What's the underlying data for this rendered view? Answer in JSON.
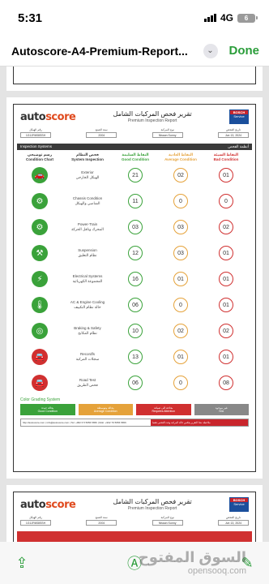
{
  "status": {
    "time": "5:31",
    "network": "4G",
    "battery": "6"
  },
  "nav": {
    "title": "Autoscore-A4-Premium-Report...",
    "done": "Done"
  },
  "report": {
    "logo_a": "auto",
    "logo_b": "score",
    "title_ar": "تقرير فحص المركبات الشامل",
    "title_en": "Premium Inspection Report",
    "bosch_top": "BOSCH",
    "bosch_bottom": "Service",
    "info": [
      {
        "label": "رقم الهيكل",
        "value": "1G1JR6S8SSH"
      },
      {
        "label": "سنة الصنع",
        "value": "2004"
      },
      {
        "label": "نوع المركبة",
        "value": "Nissan Sunny"
      },
      {
        "label": "تاريخ الفحص",
        "value": "Jun 13, 2024"
      }
    ],
    "section_en": "Inspection Systems",
    "section_ar": "أنظمة الفحص",
    "headers": {
      "chart_ar": "رسم توضيحي",
      "chart_en": "Condition Chart",
      "sys_ar": "فحص النظام",
      "sys_en": "System Inspection",
      "good_ar": "النقاط السليمة",
      "good_en": "Good Condition",
      "avg_ar": "النقاط العادية",
      "avg_en": "Average Condition",
      "bad_ar": "النقاط السيئة",
      "bad_en": "Bad Condition"
    },
    "rows": [
      {
        "en": "Exterior",
        "ar": "الهيكل الخارجي",
        "good": "21",
        "avg": "02",
        "bad": "01",
        "icon": "car-icon",
        "glyph": "🚗",
        "red": false
      },
      {
        "en": "Chassis Condition",
        "ar": "الشاصي والهيكل",
        "good": "11",
        "avg": "0",
        "bad": "0",
        "icon": "chassis-icon",
        "glyph": "⚙",
        "red": false
      },
      {
        "en": "Power-Train",
        "ar": "المحرك وناقل الحركة",
        "good": "03",
        "avg": "03",
        "bad": "02",
        "icon": "engine-icon",
        "glyph": "⚙",
        "red": false
      },
      {
        "en": "Suspension",
        "ar": "نظام التعليق",
        "good": "12",
        "avg": "03",
        "bad": "01",
        "icon": "suspension-icon",
        "glyph": "⚒",
        "red": false
      },
      {
        "en": "Electrical Systems",
        "ar": "المجموعة الكهربائية",
        "good": "16",
        "avg": "01",
        "bad": "01",
        "icon": "battery-icon",
        "glyph": "⚡",
        "red": false
      },
      {
        "en": "AC & Engine Cooling",
        "ar": "حالة نظام التكييف",
        "good": "06",
        "avg": "0",
        "bad": "01",
        "icon": "thermometer-icon",
        "glyph": "🌡",
        "red": false
      },
      {
        "en": "Braking & Safety",
        "ar": "نظام المكابح",
        "good": "10",
        "avg": "02",
        "bad": "02",
        "icon": "brake-icon",
        "glyph": "◎",
        "red": false
      },
      {
        "en": "Recordfs",
        "ar": "سجلات المركبة",
        "good": "13",
        "avg": "01",
        "bad": "01",
        "icon": "records-icon",
        "glyph": "🚘",
        "red": true
      },
      {
        "en": "Road Test",
        "ar": "فحص الطريق",
        "good": "06",
        "avg": "0",
        "bad": "08",
        "icon": "road-test-icon",
        "glyph": "🚘",
        "red": true
      }
    ],
    "legend_title": "Color Grading System",
    "legend": [
      {
        "ar": "بحالة جيدة",
        "en": "Good Condition"
      },
      {
        "ar": "بحالة متوسطة",
        "en": "Average Condition"
      },
      {
        "ar": "بحاجة الى صيانة",
        "en": "Requires Attention"
      },
      {
        "ar": "غير موجود",
        "en": "N/A"
      }
    ],
    "footer_left": "http://autoscore.com | info@autoscore.com | Tel: +962 6 5 5656 5656 | Mob: +962 79 5656 5656",
    "footer_right": "ملاحظة: هذا التقرير يعكس حالة المركبة وقت الفحص فقط"
  },
  "toolbar": [
    "share-icon",
    "markup-icon",
    "sign-icon"
  ],
  "watermark": {
    "line1": "السوق المفتوح",
    "line2": "opensooq.com"
  }
}
